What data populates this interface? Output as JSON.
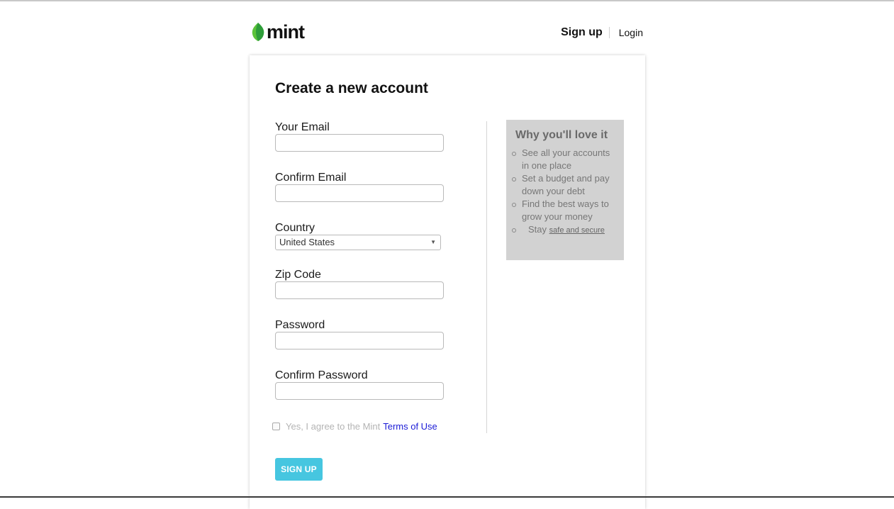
{
  "header": {
    "logo_text": "mint",
    "nav_signup": "Sign up",
    "nav_login": "Login"
  },
  "form": {
    "title": "Create a new account",
    "fields": {
      "email_label": "Your Email",
      "email_value": "",
      "confirm_email_label": "Confirm Email",
      "confirm_email_value": "",
      "country_label": "Country",
      "country_value": "United States",
      "zip_label": "Zip Code",
      "zip_value": "",
      "password_label": "Password",
      "confirm_password_label": "Confirm Password"
    },
    "agree_text": "Yes, I agree to the Mint",
    "terms_link": "Terms of Use",
    "agree_checked": false,
    "submit_label": "SIGN UP"
  },
  "promo": {
    "title": "Why you'll love it",
    "items": [
      "See all your accounts in one place",
      "Set a budget and pay down your debt",
      "Find the best ways to grow your money"
    ],
    "last_item_prefix": "Stay",
    "last_item_link": "safe and secure"
  },
  "colors": {
    "brand_green": "#5cc33a",
    "button": "#46c6e0",
    "link": "#1a1ad6",
    "promo_bg": "#d2d2d2"
  },
  "icons": {
    "logo": "mint-leaf-icon",
    "select_arrow": "dropdown-arrow-icon"
  }
}
